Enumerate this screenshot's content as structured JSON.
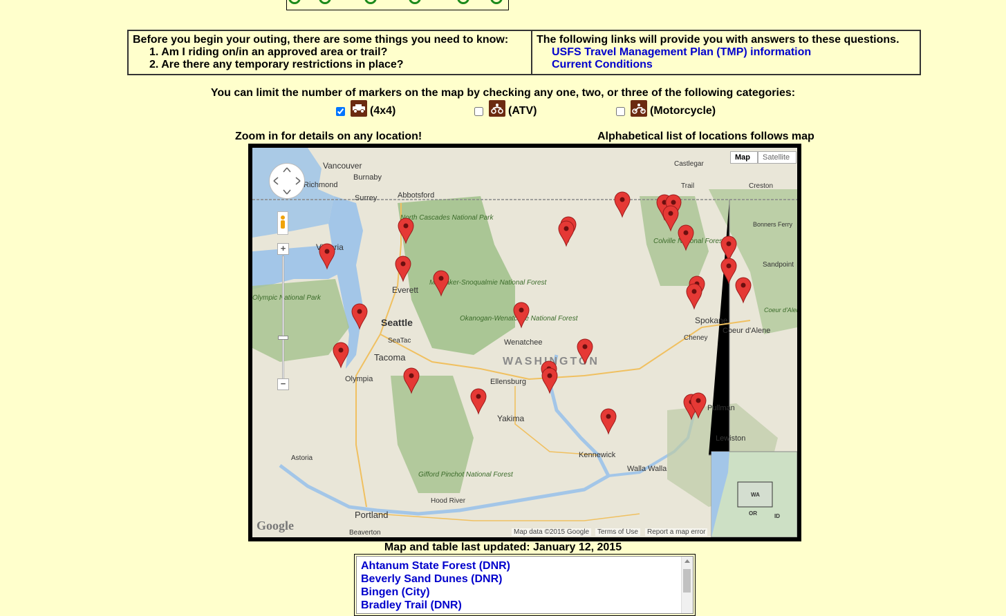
{
  "info": {
    "left_intro": "Before you begin your outing, there are some things you need to know:",
    "left_q1": "1. Am I riding on/in an approved area or trail?",
    "left_q2": "2. Are there any temporary restrictions in place?",
    "right_intro": "The following links will provide you with answers to these questions.",
    "link_tmp": "USFS Travel Management Plan (TMP) information",
    "link_conditions": "Current Conditions"
  },
  "filter": {
    "prompt": "You can limit the number of markers on the map by checking any one, two, or three of the following categories:",
    "options": [
      {
        "label": "(4x4)",
        "checked": true,
        "icon": "4x4-icon"
      },
      {
        "label": "(ATV)",
        "checked": false,
        "icon": "atv-icon"
      },
      {
        "label": "(Motorcycle)",
        "checked": false,
        "icon": "motorcycle-icon"
      }
    ]
  },
  "captions": {
    "zoom": "Zoom in for details on any location!",
    "alpha": "Alphabetical list of locations follows map"
  },
  "map": {
    "type_map": "Map",
    "type_satellite": "Satellite",
    "state_label": "WASHINGTON",
    "cities": [
      "Vancouver",
      "Burnaby",
      "Richmond",
      "Surrey",
      "Abbotsford",
      "Victoria",
      "Everett",
      "Seattle",
      "SeaTac",
      "Tacoma",
      "Olympia",
      "Ellensburg",
      "Wenatchee",
      "Yakima",
      "Kennewick",
      "Walla Walla",
      "Pullman",
      "Lewiston",
      "Spokane",
      "Cheney",
      "Coeur d'Alene",
      "Sandpoint",
      "Castlegar",
      "Creston",
      "Trail",
      "Bonners Ferry",
      "Astoria",
      "Portland",
      "Beaverton",
      "Hood River",
      "North Cascades National Park",
      "Mt. Baker-Snoqualmie National Forest",
      "Okanogan-Wenatchee National Forest",
      "Colville National Forest",
      "Gifford Pinchot National Forest",
      "Olympic National Park",
      "Coeur d'Alene National Forest"
    ],
    "inset_labels": [
      "WA",
      "OR",
      "ID"
    ],
    "footer_data": "Map data ©2015 Google",
    "footer_terms": "Terms of Use",
    "footer_report": "Report a map error",
    "logo": "Google"
  },
  "updated": "Map and table last updated: January 12, 2015",
  "locations": [
    "Ahtanum State Forest (DNR)",
    "Beverly Sand Dunes (DNR)",
    "Bingen (City)",
    "Bradley Trail (DNR)"
  ]
}
